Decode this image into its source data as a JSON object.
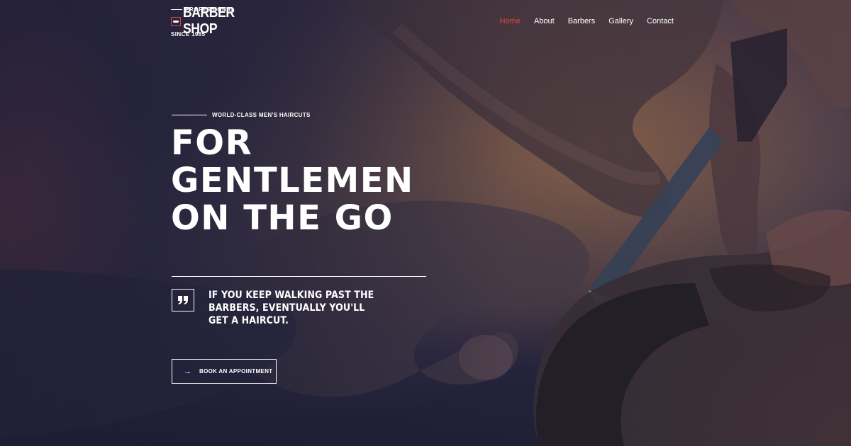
{
  "logo": {
    "top": "PROFESSIONAL",
    "main": "BARBER SHOP",
    "sub": "SINCE 1985"
  },
  "nav": {
    "items": [
      {
        "label": "Home",
        "active": true
      },
      {
        "label": "About"
      },
      {
        "label": "Barbers"
      },
      {
        "label": "Gallery"
      },
      {
        "label": "Contact"
      }
    ],
    "active_color": "#e3453e"
  },
  "hero": {
    "eyebrow": "WORLD-CLASS MEN'S HAIRCUTS",
    "headline_lines": [
      "FOR",
      "GENTLEMEN",
      "ON THE GO"
    ],
    "quote": "IF YOU KEEP WALKING PAST THE BARBERS, EVENTUALLY YOU'LL GET A HAIRCUT.",
    "quote_icon": "quote-icon",
    "cta_label": "BOOK AN APPOINTMENT",
    "cta_icon": "arrow-right-icon",
    "cta_arrow": "→",
    "background_icon": "barber-shaving-photo"
  },
  "colors": {
    "accent": "#e3453e",
    "overlay": "#1c1d34",
    "text": "#ffffff"
  }
}
